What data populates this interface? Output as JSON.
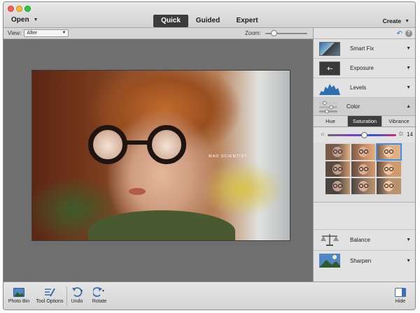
{
  "toolbar": {
    "open_label": "Open",
    "modes": [
      "Quick",
      "Guided",
      "Expert"
    ],
    "active_mode": "Quick",
    "create_label": "Create"
  },
  "options": {
    "view_label": "View:",
    "view_value": "After",
    "zoom_label": "Zoom:",
    "zoom_level": 0.2
  },
  "photo": {
    "caption": "MAD SCIENTIST"
  },
  "panel": {
    "adjustments": [
      {
        "label": "Smart Fix",
        "icon": "smart-fix-icon"
      },
      {
        "label": "Exposure",
        "icon": "exposure-icon",
        "symbol": "+-"
      },
      {
        "label": "Levels",
        "icon": "levels-icon"
      }
    ],
    "color": {
      "label": "Color",
      "tabs": [
        "Hue",
        "Saturation",
        "Vibrance"
      ],
      "active_tab": "Saturation",
      "saturation_value": "14",
      "saturation_level": 0.53,
      "selected_preset": 2
    },
    "bottom_adjustments": [
      {
        "label": "Balance",
        "icon": "balance-icon"
      },
      {
        "label": "Sharpen",
        "icon": "sharpen-icon"
      }
    ]
  },
  "bottombar": {
    "photo_bin": "Photo Bin",
    "tool_options": "Tool Options",
    "undo": "Undo",
    "rotate": "Rotate",
    "hide": "Hide"
  },
  "colors": {
    "accent": "#3d8ff0",
    "active_tab_bg": "#3c3c3c",
    "canvas_bg": "#6f6f6f"
  }
}
